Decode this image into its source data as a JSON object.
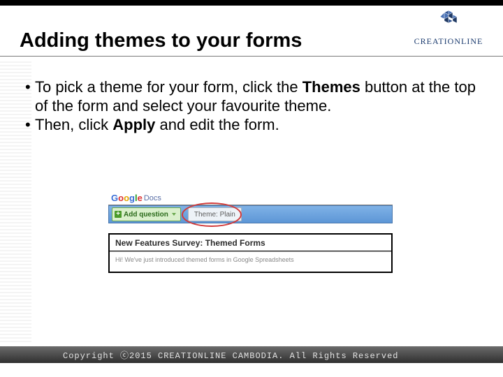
{
  "brand": {
    "name": "CREATIONLINE"
  },
  "title": "Adding themes to your forms",
  "bullets": [
    {
      "pre": "To pick a theme for your form, click the ",
      "bold": "Themes",
      "post": " button at the top of the form and select your favourite theme."
    },
    {
      "pre": "Then, click ",
      "bold": "Apply",
      "post": " and edit the form."
    }
  ],
  "screenshot": {
    "docs_label": "Docs",
    "add_question": "Add question",
    "theme_button": "Theme: Plain",
    "form_title": "New Features Survey: Themed Forms",
    "form_body": "Hi! We've just introduced themed forms in Google Spreadsheets"
  },
  "footer": "Copyright ⓒ2015 CREATIONLINE CAMBODIA. All Rights Reserved"
}
